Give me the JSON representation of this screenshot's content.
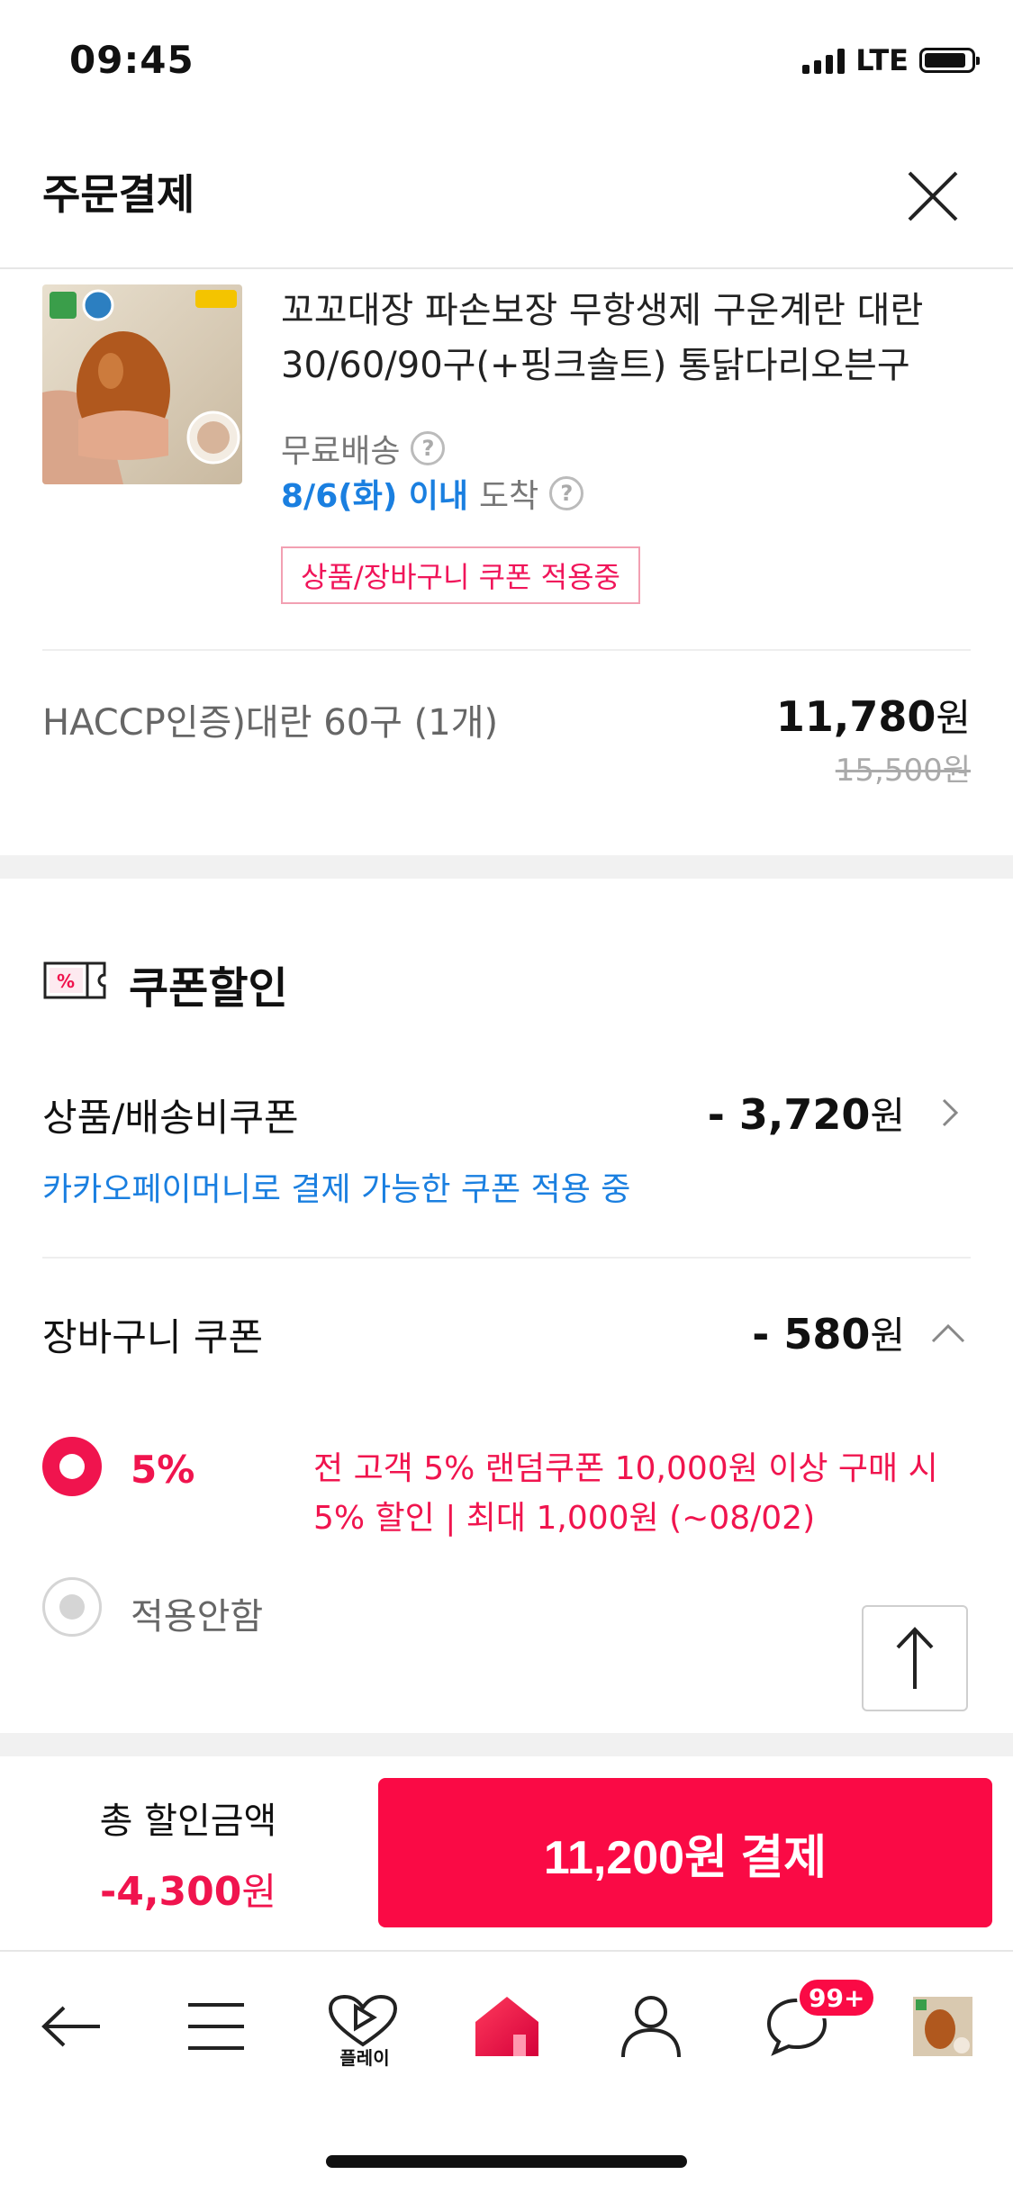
{
  "status_bar": {
    "time": "09:45",
    "network": "LTE"
  },
  "header": {
    "title": "주문결제"
  },
  "product": {
    "title": "꼬꼬대장 파손보장 무항생제 구운계란 대란 30/60/90구(+핑크솔트) 통닭다리오븐구",
    "shipping": "무료배송",
    "arrival_date": "8/6(화) 이내",
    "arrival_suffix": "도착",
    "coupon_tag": "상품/장바구니 쿠폰 적용중",
    "option": "HACCP인증)대란 60구 (1개)",
    "price": "11,780",
    "price_unit": "원",
    "original_price": "15,500원"
  },
  "coupon": {
    "heading": "쿠폰할인",
    "product_coupon": {
      "label": "상품/배송비쿠폰",
      "amount": "- 3,720",
      "unit": "원",
      "note": "카카오페이머니로 결제 가능한 쿠폰 적용 중"
    },
    "cart_coupon": {
      "label": "장바구니 쿠폰",
      "amount": "- 580",
      "unit": "원"
    },
    "options": [
      {
        "percent": "5%",
        "description": "전 고객 5% 랜덤쿠폰 10,000원 이상 구매 시 5% 할인 | 최대 1,000원 (~08/02)",
        "selected": true
      },
      {
        "label": "적용안함",
        "selected": false
      }
    ]
  },
  "summary": {
    "label": "총 할인금액",
    "amount": "-4,300",
    "unit": "원",
    "pay_button": "11,200원 결제"
  },
  "nav": {
    "play_label": "플레이",
    "badge": "99+"
  },
  "colors": {
    "accent": "#fa0a45",
    "link": "#1a7fe0"
  }
}
